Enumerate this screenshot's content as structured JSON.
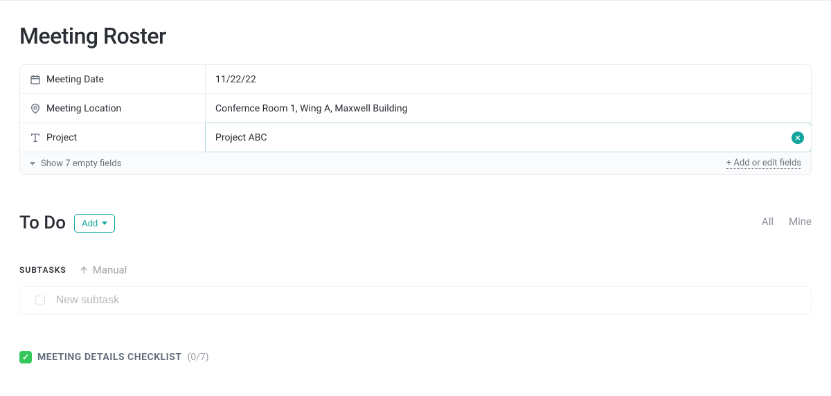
{
  "title": "Meeting Roster",
  "fields": {
    "meeting_date": {
      "label": "Meeting Date",
      "value": "11/22/22"
    },
    "meeting_location": {
      "label": "Meeting Location",
      "value": "Confernce Room 1, Wing A, Maxwell Building"
    },
    "project": {
      "label": "Project",
      "value": "Project ABC"
    }
  },
  "panel_footer": {
    "show_empty": "Show 7 empty fields",
    "add_edit": "+ Add or edit fields"
  },
  "todo": {
    "title": "To Do",
    "add_label": "Add",
    "filters": {
      "all": "All",
      "mine": "Mine"
    },
    "subtasks_label": "SUBTASKS",
    "sort_mode": "Manual",
    "new_subtask_placeholder": "New subtask"
  },
  "checklist": {
    "title": "MEETING DETAILS CHECKLIST",
    "count": "(0/7)"
  }
}
